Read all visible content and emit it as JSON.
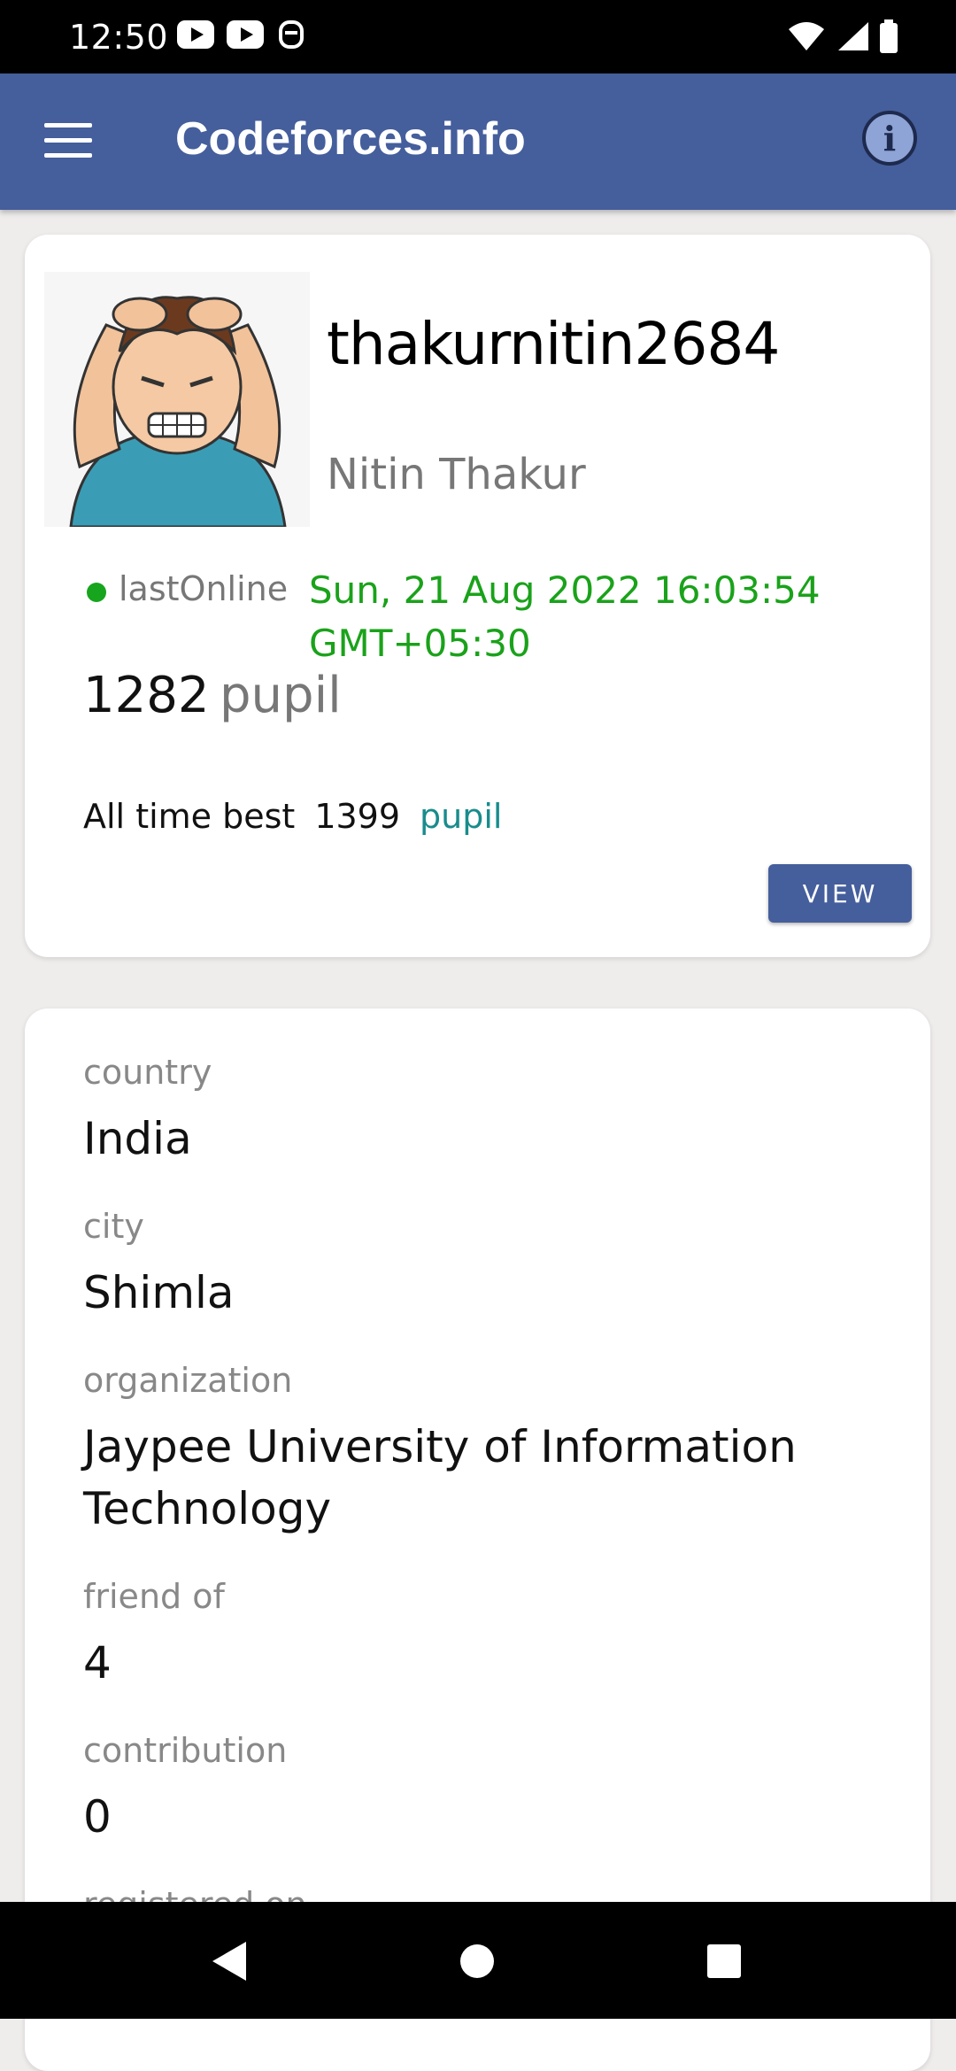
{
  "status_bar": {
    "time": "12:50"
  },
  "app_bar": {
    "title": "Codeforces.info",
    "info_glyph": "i"
  },
  "profile": {
    "handle": "thakurnitin2684",
    "full_name": "Nitin Thakur",
    "online_label": "lastOnline",
    "online_time": "Sun, 21 Aug 2022 16:03:54 GMT+05:30",
    "rating": "1282",
    "rank": "pupil",
    "best_label": "All time best",
    "best_rating": "1399",
    "best_rank": "pupil",
    "view_button": "VIEW"
  },
  "details": [
    {
      "label": "country",
      "value": "India"
    },
    {
      "label": "city",
      "value": "Shimla"
    },
    {
      "label": "organization",
      "value": "Jaypee University of Information Technology"
    },
    {
      "label": "friend of",
      "value": "4"
    },
    {
      "label": "contribution",
      "value": "0"
    },
    {
      "label": "registered on",
      "value": ""
    }
  ],
  "colors": {
    "app_bar": "#455e9c",
    "online": "#1aa21a",
    "best_rank": "#198c8c"
  },
  "icons": [
    "youtube-icon",
    "youtube-icon",
    "assistant-icon",
    "wifi-icon",
    "signal-icon",
    "battery-icon",
    "menu-icon",
    "info-icon",
    "back-icon",
    "home-icon",
    "recents-icon"
  ]
}
